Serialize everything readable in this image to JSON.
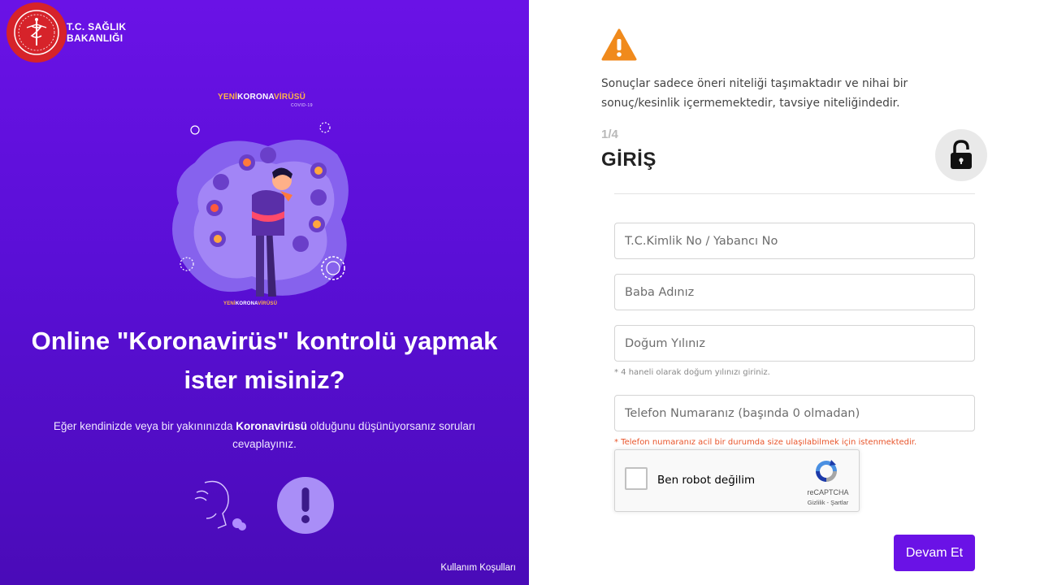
{
  "left": {
    "logo_line1": "T.C. SAĞLIK",
    "logo_line2": "BAKANLIĞI",
    "brand_yeni": "YENİ",
    "brand_korona": "KORONA",
    "brand_virusu": "VİRÜSÜ",
    "brand_covid": "COVID-19",
    "headline_line1": "Online \"Koronavirüs\" kontrolü yapmak",
    "headline_line2": "ister misiniz?",
    "sub_pre": "Eğer kendinizde veya bir yakınınızda ",
    "sub_bold": "Koronavirüsü",
    "sub_post": " olduğunu düşünüyorsanız soruları cevaplayınız.",
    "terms": "Kullanım Koşulları",
    "bg_color": "#6a12e6"
  },
  "right": {
    "disclaimer": "Sonuçlar sadece öneri niteliği taşımaktadır ve nihai bir sonuç/kesinlik içermemektedir, tavsiye niteliğindedir.",
    "step": "1/4",
    "title": "GİRİŞ",
    "fields": {
      "tc_placeholder": "T.C.Kimlik No / Yabancı No",
      "father_placeholder": "Baba Adınız",
      "birth_placeholder": "Doğum Yılınız",
      "phone_placeholder": "Telefon Numaranız (başında 0 olmadan)"
    },
    "birth_hint": "* 4 haneli olarak doğum yılınızı giriniz.",
    "phone_hint": "* Telefon numaranız acil bir durumda size ulaşılabilmek için istenmektedir.",
    "captcha": {
      "label": "Ben robot değilim",
      "brand": "reCAPTCHA",
      "links": "Gizlilik - Şartlar"
    },
    "submit": "Devam Et",
    "accent_color": "#6a12e6",
    "warning_color": "#f08a1c"
  }
}
